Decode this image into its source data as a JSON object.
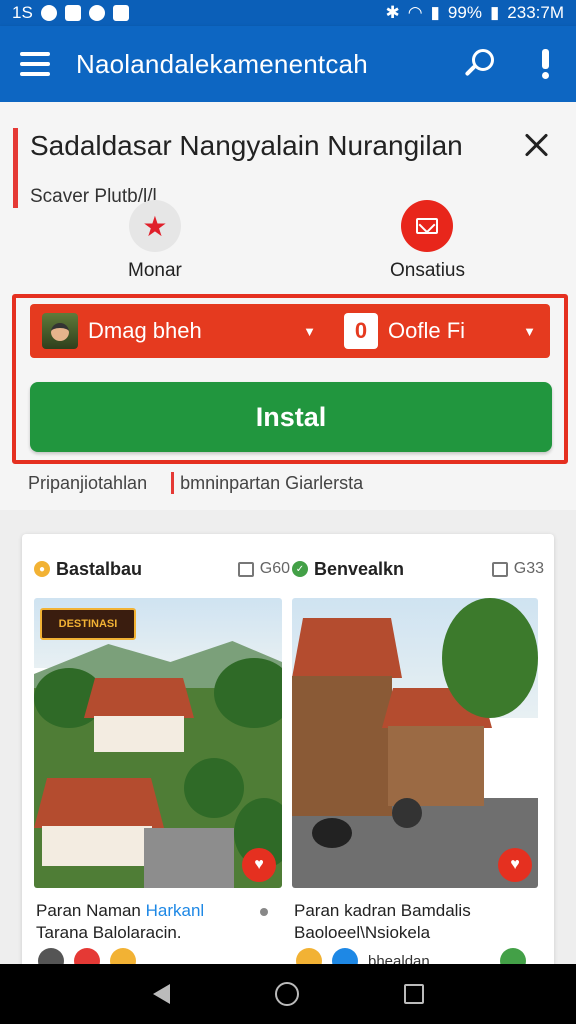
{
  "status_bar": {
    "left_text": "1S",
    "battery": "99%",
    "time": "233:7M"
  },
  "app_bar": {
    "title": "Naolandalekamenentcah"
  },
  "header": {
    "title": "Sadaldasar Nangyalain Nurangilan",
    "subtitle": "Scaver Plutb/l/l",
    "quick_actions": [
      {
        "label": "Monar",
        "icon": "star-icon",
        "color": "#e0202b"
      },
      {
        "label": "Onsatius",
        "icon": "mail-icon",
        "color": "#e8261b"
      }
    ]
  },
  "selector_row": {
    "left_label": "Dmag bheh",
    "right_label": "Oofle Fi",
    "right_icon_text": "0"
  },
  "install_label": "Instal",
  "links": [
    "Pripanjiotahlan",
    "bmninpartan Giarlersta"
  ],
  "listing": {
    "columns": [
      {
        "name": "Bastalbau",
        "count": "G60",
        "badge_color": "#f2b234",
        "caption_line1": "Paran Naman",
        "caption_tag": "Harkanl",
        "caption_line2": "Tarana Balolaracin.",
        "banner_text": "DESTINASI"
      },
      {
        "name": "Benvealkn",
        "count": "G33",
        "badge_color": "#43a047",
        "caption_line1": "Paran kadran Bamdalis",
        "caption_line2": "Baoloeel\\Nsiokela",
        "chip_label": "bhealdan"
      }
    ]
  },
  "colors": {
    "primary": "#0d66c2",
    "accent_red": "#e53a1f",
    "install_green": "#21963e"
  }
}
